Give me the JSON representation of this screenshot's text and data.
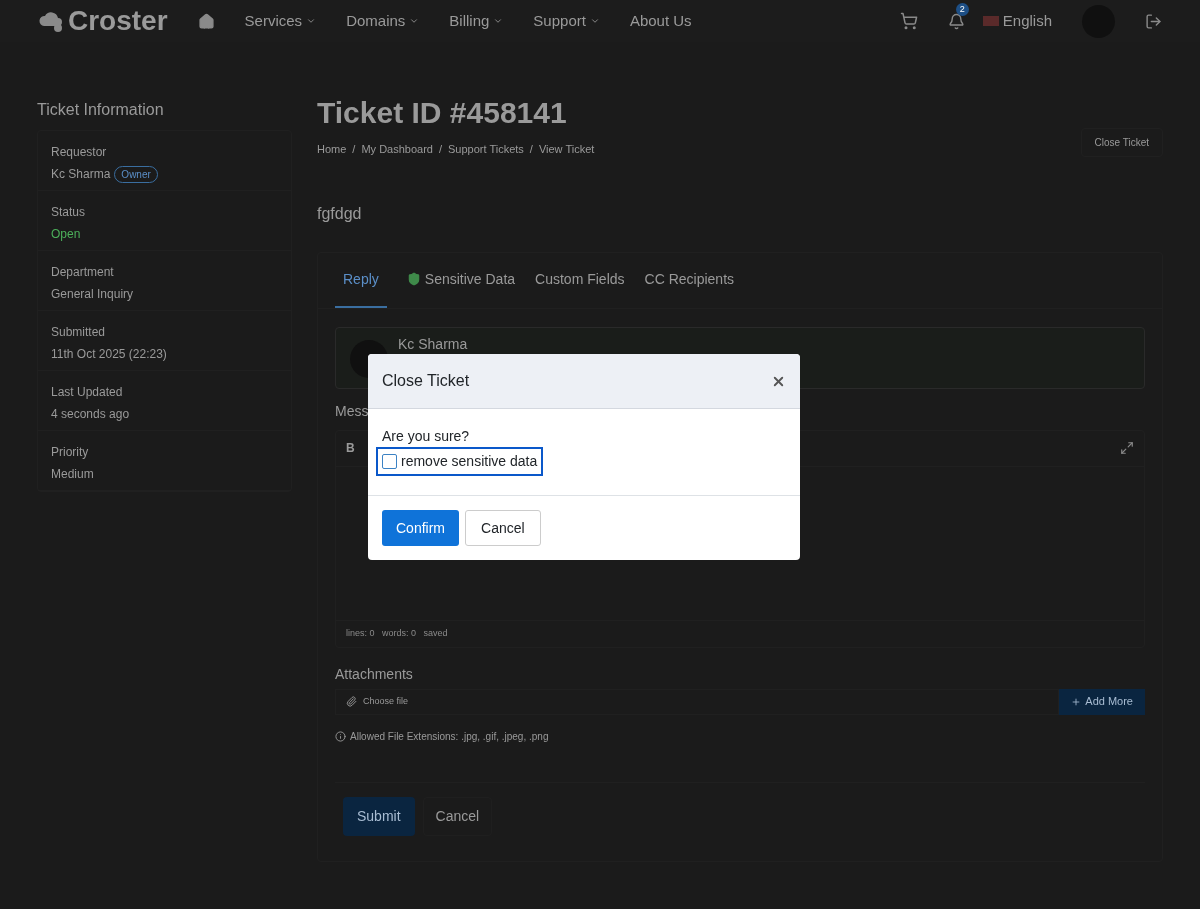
{
  "nav": {
    "logo": "Croster",
    "menu": [
      {
        "label": "Services",
        "dropdown": true
      },
      {
        "label": "Domains",
        "dropdown": true
      },
      {
        "label": "Billing",
        "dropdown": true
      },
      {
        "label": "Support",
        "dropdown": true
      },
      {
        "label": "About Us",
        "dropdown": false
      }
    ],
    "notifications": "2",
    "language": "English"
  },
  "sidebar": {
    "title": "Ticket Information",
    "fields": [
      {
        "label": "Requestor",
        "value": "Kc Sharma",
        "badge": "Owner",
        "kind": "text"
      },
      {
        "label": "Status",
        "value": "Open",
        "kind": "status"
      },
      {
        "label": "Department",
        "value": "General Inquiry",
        "kind": "text"
      },
      {
        "label": "Submitted",
        "value": "11th Oct 2025 (22:23)",
        "kind": "text"
      },
      {
        "label": "Last Updated",
        "value": "4 seconds ago",
        "kind": "text"
      },
      {
        "label": "Priority",
        "value": "Medium",
        "kind": "text"
      }
    ]
  },
  "ticket": {
    "title": "Ticket ID #458141",
    "breadcrumb": [
      "Home",
      "My Dashboard",
      "Support Tickets",
      "View Ticket"
    ],
    "separator": "/",
    "close_button": "Close Ticket",
    "subject": "fgfdgd"
  },
  "tabs": [
    {
      "label": "Reply",
      "selected": true,
      "shield": false
    },
    {
      "label": "Sensitive Data",
      "selected": false,
      "shield": true
    },
    {
      "label": "Custom Fields",
      "selected": false,
      "shield": false
    },
    {
      "label": "CC Recipients",
      "selected": false,
      "shield": false
    }
  ],
  "reply": {
    "author": "Kc Sharma",
    "message_label": "Mess",
    "bold_button": "B",
    "editor_footer": "lines: 0   words: 0   saved",
    "attachments_label": "Attachments",
    "file_placeholder": "Choose file",
    "add_more": "Add More",
    "allowed": "Allowed File Extensions: .jpg, .gif, .jpeg, .png",
    "submit": "Submit",
    "cancel": "Cancel"
  },
  "modal": {
    "title": "Close Ticket",
    "question": "Are you sure?",
    "checkbox": {
      "label": "remove sensitive data",
      "checked": false
    },
    "confirm": "Confirm",
    "cancel": "Cancel"
  }
}
